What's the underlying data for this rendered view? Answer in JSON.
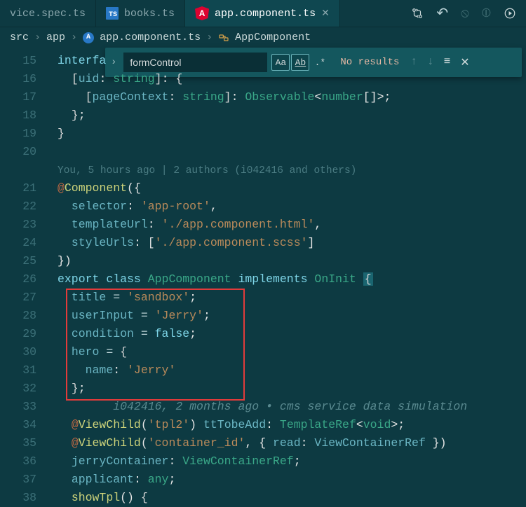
{
  "tabs": {
    "t0": {
      "label": "vice.spec.ts"
    },
    "t1": {
      "label": "books.ts"
    },
    "t2": {
      "label": "app.component.ts"
    }
  },
  "breadcrumbs": {
    "b0": "src",
    "b1": "app",
    "b2": "app.component.ts",
    "b3": "AppComponent"
  },
  "search": {
    "value": "formControl",
    "results": "No results"
  },
  "lines": {
    "l15": "15",
    "l16": "16",
    "l17": "17",
    "l18": "18",
    "l19": "19",
    "l20": "20",
    "l21": "21",
    "l22": "22",
    "l23": "23",
    "l24": "24",
    "l25": "25",
    "l26": "26",
    "l27": "27",
    "l28": "28",
    "l29": "29",
    "l30": "30",
    "l31": "31",
    "l32": "32",
    "l33": "33",
    "l34": "34",
    "l35": "35",
    "l36": "36",
    "l37": "37",
    "l38": "38"
  },
  "blame": {
    "top": "You, 5 hours ago | 2 authors (i042416 and others)",
    "mid": "i042416, 2 months ago • cms service data simulation"
  },
  "snips": {
    "interface": "interfa",
    "uid": "uid",
    "string": "string",
    "pageContext": "pageContext",
    "Observable": "Observable",
    "number": "number",
    "at": "@",
    "Component": "Component",
    "selector": "selector",
    "app_root": "'app-root'",
    "templateUrl": "templateUrl",
    "tpl_html": "'./app.component.html'",
    "styleUrls": "styleUrls",
    "scss": "'./app.component.scss'",
    "export": "export",
    "class": "class",
    "AppComponent": "AppComponent",
    "implements": "implements",
    "OnInit": "OnInit",
    "title": "title",
    "sandbox": "'sandbox'",
    "userInput": "userInput",
    "jerry": "'Jerry'",
    "condition": "condition",
    "false": "false",
    "hero": "hero",
    "name": "name",
    "ViewChild": "ViewChild",
    "tpl2": "'tpl2'",
    "ttTobeAdd": "ttTobeAdd",
    "TemplateRef": "TemplateRef",
    "void": "void",
    "container_id": "'container_id'",
    "read": "read",
    "ViewContainerRef": "ViewContainerRef",
    "jerryContainer": "jerryContainer",
    "applicant": "applicant",
    "any": "any",
    "showTpl": "showTpl",
    "brace_open": "{",
    "brace_close": "}",
    "paren_open": "(",
    "paren_close": ")",
    "brackets": "[]",
    "sq_open": "[",
    "sq_close": "]",
    "lt": "<",
    "gt": ">",
    "colon": ":",
    "semi": ";",
    "comma": ",",
    "eq": " = ",
    "space": " "
  }
}
